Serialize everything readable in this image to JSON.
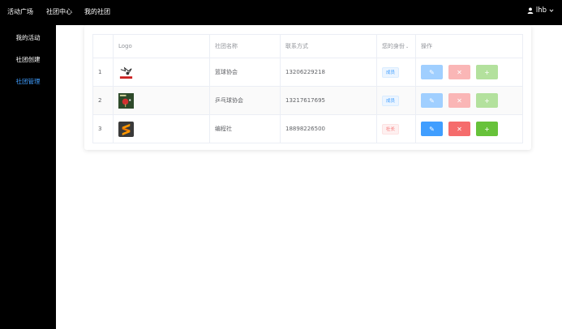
{
  "topnav": {
    "items": [
      "活动广场",
      "社团中心",
      "我的社团"
    ],
    "user": "lhb"
  },
  "sidebar": {
    "items": [
      "我的活动",
      "社团创建",
      "社团管理"
    ],
    "active_index": 2
  },
  "table": {
    "headers": {
      "index": "",
      "logo": "Logo",
      "name": "社团名称",
      "contact": "联系方式",
      "role": "您的身份",
      "ops": "操作"
    },
    "rows": [
      {
        "index": "1",
        "name": "篮球协会",
        "contact": "13206229218",
        "role": "成员",
        "role_type": "member",
        "logo_icon": "basketball-logo-icon",
        "ops_enabled": false
      },
      {
        "index": "2",
        "name": "乒乓球协会",
        "contact": "13217617695",
        "role": "成员",
        "role_type": "member",
        "logo_icon": "ping-pong-logo-icon",
        "ops_enabled": false
      },
      {
        "index": "3",
        "name": "编程社",
        "contact": "18898226500",
        "role": "社长",
        "role_type": "leader",
        "logo_icon": "sublime-logo-icon",
        "ops_enabled": true
      }
    ]
  },
  "colors": {
    "primary": "#409eff",
    "danger": "#f56c6c",
    "success": "#67c23a"
  }
}
